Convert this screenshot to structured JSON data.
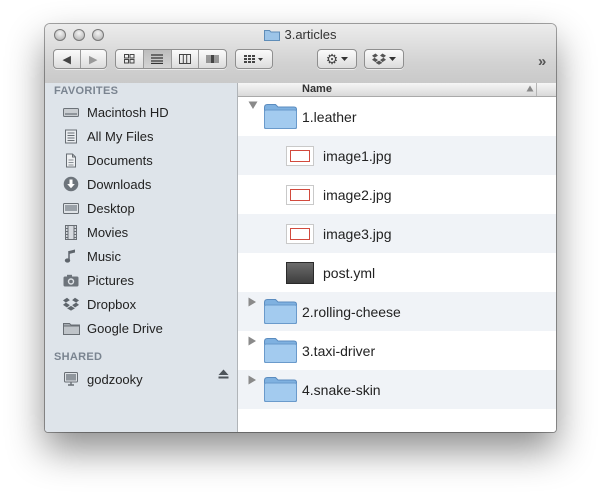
{
  "window": {
    "title": "3.articles"
  },
  "toolbar": {
    "back": "◀",
    "forward": "▶",
    "views": [
      "icon-view",
      "list-view",
      "column-view",
      "coverflow-view"
    ],
    "active_view": "list-view",
    "overflow": "»"
  },
  "column": {
    "name": "Name"
  },
  "sidebar": {
    "favorites_label": "FAVORITES",
    "shared_label": "SHARED",
    "favorites": [
      {
        "label": "Macintosh HD",
        "icon": "hard-drive-icon"
      },
      {
        "label": "All My Files",
        "icon": "all-files-icon"
      },
      {
        "label": "Documents",
        "icon": "documents-icon"
      },
      {
        "label": "Downloads",
        "icon": "downloads-icon"
      },
      {
        "label": "Desktop",
        "icon": "desktop-icon"
      },
      {
        "label": "Movies",
        "icon": "movies-icon"
      },
      {
        "label": "Music",
        "icon": "music-icon"
      },
      {
        "label": "Pictures",
        "icon": "pictures-icon"
      },
      {
        "label": "Dropbox",
        "icon": "dropbox-icon"
      },
      {
        "label": "Google Drive",
        "icon": "folder-icon"
      }
    ],
    "shared": [
      {
        "label": "godzooky",
        "icon": "computer-icon"
      }
    ]
  },
  "files": [
    {
      "name": "1.leather",
      "kind": "folder",
      "expanded": true
    },
    {
      "name": "image1.jpg",
      "kind": "image"
    },
    {
      "name": "image2.jpg",
      "kind": "image"
    },
    {
      "name": "image3.jpg",
      "kind": "image"
    },
    {
      "name": "post.yml",
      "kind": "document"
    },
    {
      "name": "2.rolling-cheese",
      "kind": "folder",
      "expanded": false
    },
    {
      "name": "3.taxi-driver",
      "kind": "folder",
      "expanded": false
    },
    {
      "name": "4.snake-skin",
      "kind": "folder",
      "expanded": false
    }
  ],
  "colors": {
    "sidebar_bg": "#dee4ea",
    "row_alt": "#f0f3f7",
    "folder": "#8fbde6"
  }
}
